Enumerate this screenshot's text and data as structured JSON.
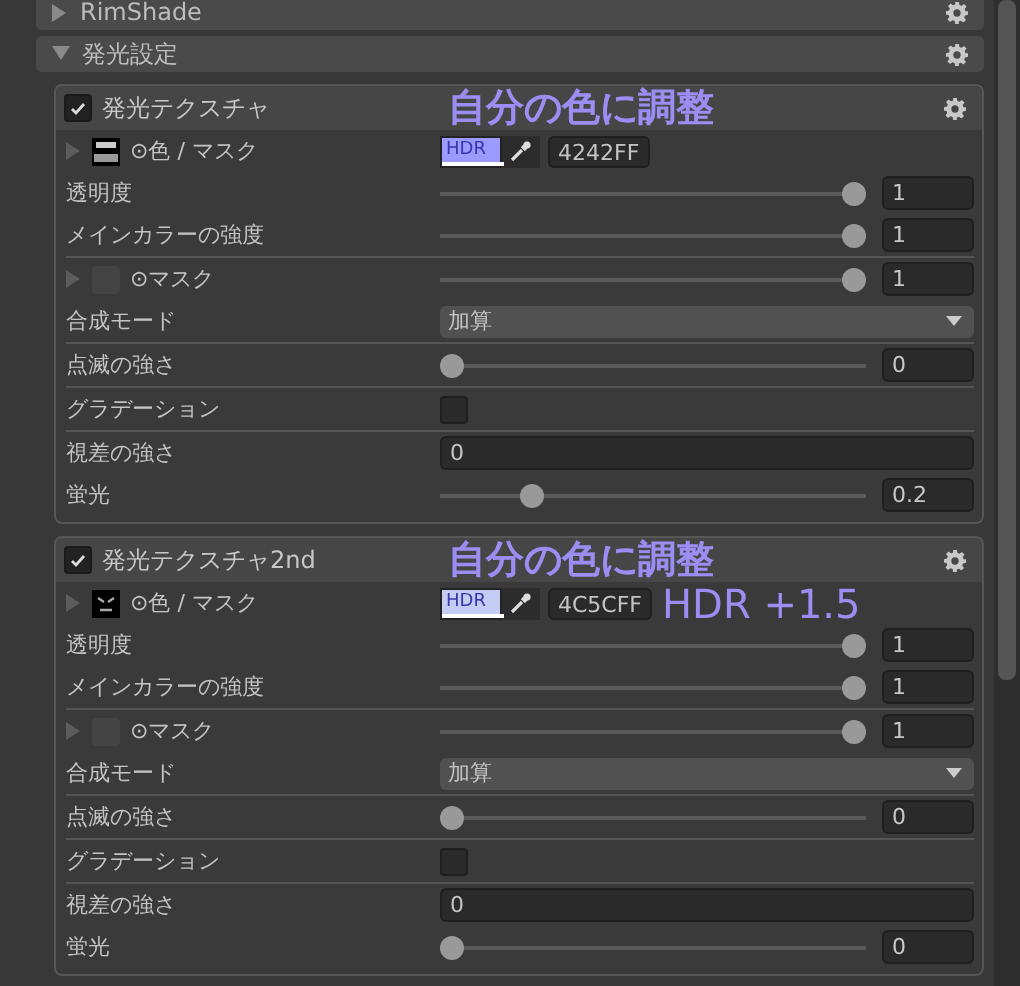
{
  "headers": [
    {
      "label": "RimShade",
      "expanded": false
    },
    {
      "label": "発光設定",
      "expanded": true
    }
  ],
  "sections": [
    {
      "title": "発光テクスチャ",
      "enabled": true,
      "annotations": [
        {
          "kind": "title",
          "text": "自分の色に調整"
        }
      ],
      "rows": [
        {
          "kind": "color",
          "label": "⊙色 / マスク",
          "expanded": false,
          "swatch_label": "HDR",
          "color": "#9a9aff",
          "hex": "4242FF"
        },
        {
          "kind": "slider",
          "label": "透明度",
          "level": 1,
          "value": "1"
        },
        {
          "kind": "slider",
          "label": "メインカラーの強度",
          "level": 1,
          "value": "1",
          "divider": true
        },
        {
          "kind": "mask",
          "label": "⊙マスク",
          "expanded": false,
          "level": 1,
          "value": "1"
        },
        {
          "kind": "dropdown",
          "label": "合成モード",
          "value": "加算",
          "divider": true
        },
        {
          "kind": "slider",
          "label": "点滅の強さ",
          "level": 0,
          "value": "0",
          "divider": true
        },
        {
          "kind": "checkbox",
          "label": "グラデーション",
          "checked": false,
          "divider": true
        },
        {
          "kind": "number",
          "label": "視差の強さ",
          "value": "0"
        },
        {
          "kind": "slider",
          "label": "蛍光",
          "level": 0.2,
          "value": "0.2"
        }
      ]
    },
    {
      "title": "発光テクスチャ2nd",
      "enabled": true,
      "annotations": [
        {
          "kind": "title",
          "text": "自分の色に調整"
        },
        {
          "kind": "note",
          "text": "HDR +1.5"
        }
      ],
      "rows": [
        {
          "kind": "color",
          "label": "⊙色 / マスク",
          "expanded": false,
          "swatch_label": "HDR",
          "color": "#c4ccf4",
          "hex": "4C5CFF"
        },
        {
          "kind": "slider",
          "label": "透明度",
          "level": 1,
          "value": "1"
        },
        {
          "kind": "slider",
          "label": "メインカラーの強度",
          "level": 1,
          "value": "1",
          "divider": true
        },
        {
          "kind": "mask",
          "label": "⊙マスク",
          "expanded": false,
          "level": 1,
          "value": "1"
        },
        {
          "kind": "dropdown",
          "label": "合成モード",
          "value": "加算",
          "divider": true
        },
        {
          "kind": "slider",
          "label": "点滅の強さ",
          "level": 0,
          "value": "0",
          "divider": true
        },
        {
          "kind": "checkbox",
          "label": "グラデーション",
          "checked": false,
          "divider": true
        },
        {
          "kind": "number",
          "label": "視差の強さ",
          "value": "0"
        },
        {
          "kind": "slider",
          "label": "蛍光",
          "level": 0,
          "value": "0"
        }
      ]
    }
  ]
}
